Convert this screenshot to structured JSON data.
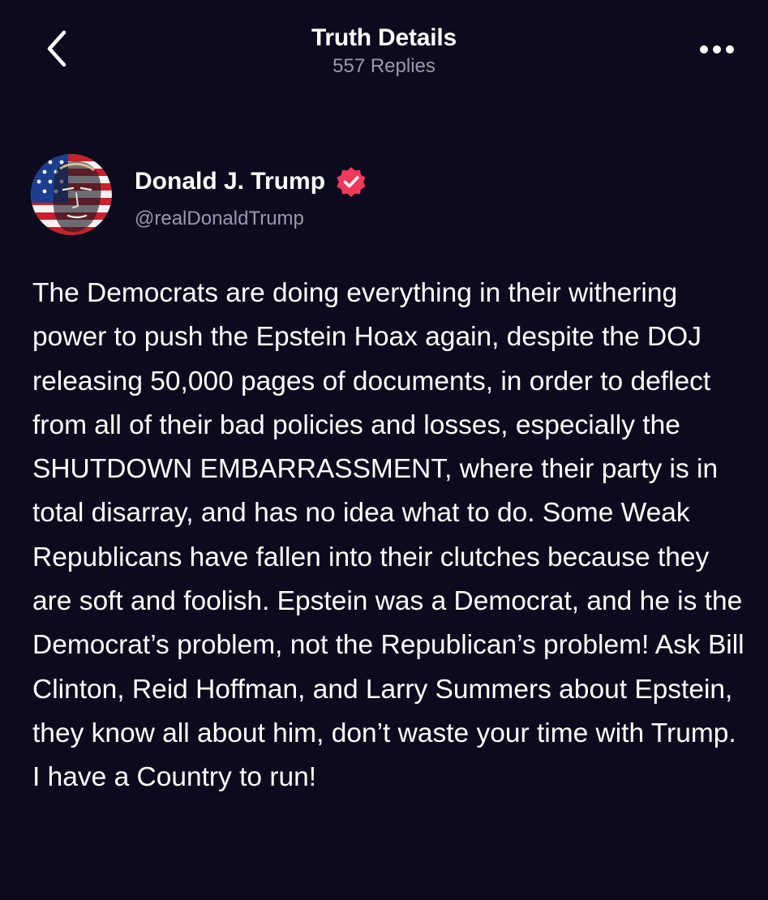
{
  "header": {
    "title": "Truth Details",
    "subtitle": "557 Replies",
    "back_icon": "chevron-left-icon",
    "more_icon": "more-horizontal-icon"
  },
  "author": {
    "name": "Donald J. Trump",
    "handle": "@realDonaldTrump",
    "verified": true,
    "badge_color": "#f0375c"
  },
  "post": {
    "text": "The Democrats are doing everything in their withering power to push the Epstein Hoax again, despite the DOJ releasing 50,000 pages of documents, in order to deflect from all of their bad policies and losses, especially the SHUTDOWN EMBARRASSMENT, where their party is in total disarray, and has no idea what to do. Some Weak Republicans have fallen into their clutches because they are soft and foolish. Epstein was a Democrat, and he is the Democrat’s problem, not the Republican’s problem! Ask Bill Clinton, Reid Hoffman, and Larry Summers about Epstein, they know all about him, don’t waste your time with Trump. I have a Country to run!"
  },
  "colors": {
    "background": "#0c0b1e",
    "text_primary": "#ffffff",
    "text_secondary": "#9a98ad"
  }
}
